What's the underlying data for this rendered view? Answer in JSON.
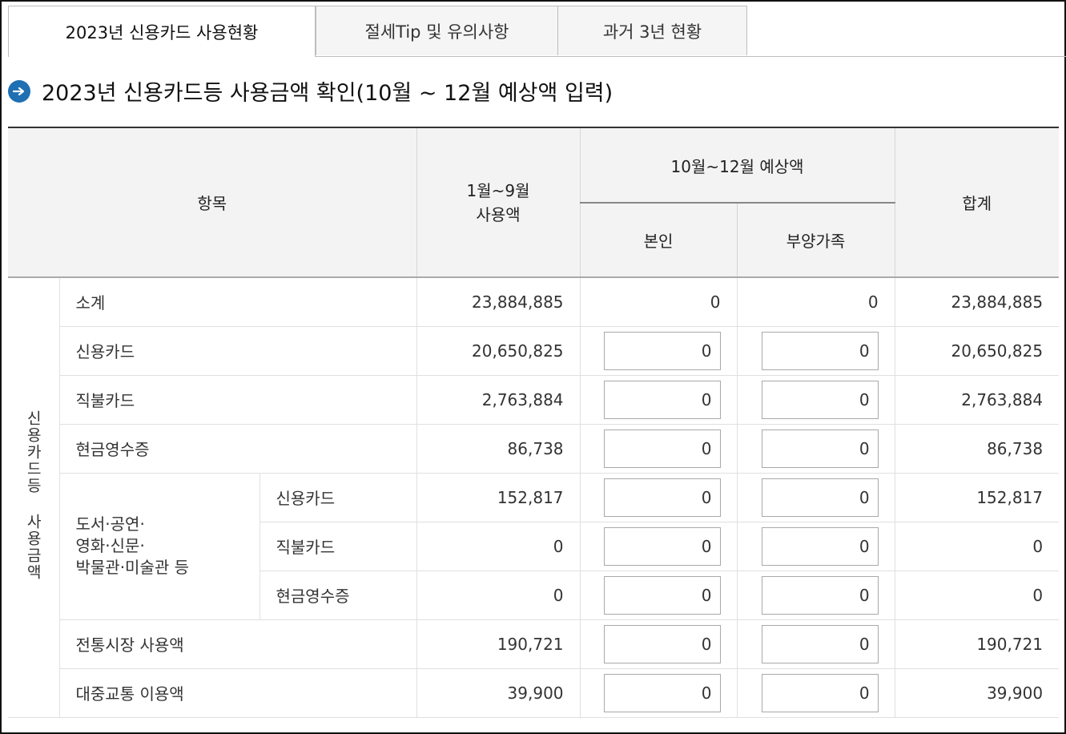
{
  "tabs": [
    {
      "label": "2023년 신용카드 사용현황",
      "active": true
    },
    {
      "label": "절세Tip 및 유의사항",
      "active": false
    },
    {
      "label": "과거 3년 현황",
      "active": false
    }
  ],
  "section": {
    "title": "2023년 신용카드등 사용금액 확인(10월 ~ 12월 예상액 입력)",
    "icon": "arrow-right-icon"
  },
  "table": {
    "headers": {
      "item": "항목",
      "jan_sep": "1월~9월\n사용액",
      "oct_dec": "10월~12월 예상액",
      "self": "본인",
      "dependent": "부양가족",
      "total": "합계"
    },
    "group_label": "신용카드등 사용금액",
    "subgroup_label": "도서·공연·\n영화·신문·\n박물관·미술관 등",
    "rows": [
      {
        "label": "소계",
        "jan_sep": "23,884,885",
        "self": "0",
        "dependent": "0",
        "total": "23,884,885"
      },
      {
        "label": "신용카드",
        "jan_sep": "20,650,825",
        "self": "0",
        "dependent": "0",
        "total": "20,650,825"
      },
      {
        "label": "직불카드",
        "jan_sep": "2,763,884",
        "self": "0",
        "dependent": "0",
        "total": "2,763,884"
      },
      {
        "label": "현금영수증",
        "jan_sep": "86,738",
        "self": "0",
        "dependent": "0",
        "total": "86,738"
      },
      {
        "label": "신용카드",
        "jan_sep": "152,817",
        "self": "0",
        "dependent": "0",
        "total": "152,817"
      },
      {
        "label": "직불카드",
        "jan_sep": "0",
        "self": "0",
        "dependent": "0",
        "total": "0"
      },
      {
        "label": "현금영수증",
        "jan_sep": "0",
        "self": "0",
        "dependent": "0",
        "total": "0"
      },
      {
        "label": "전통시장 사용액",
        "jan_sep": "190,721",
        "self": "0",
        "dependent": "0",
        "total": "190,721"
      },
      {
        "label": "대중교통 이용액",
        "jan_sep": "39,900",
        "self": "0",
        "dependent": "0",
        "total": "39,900"
      }
    ]
  }
}
